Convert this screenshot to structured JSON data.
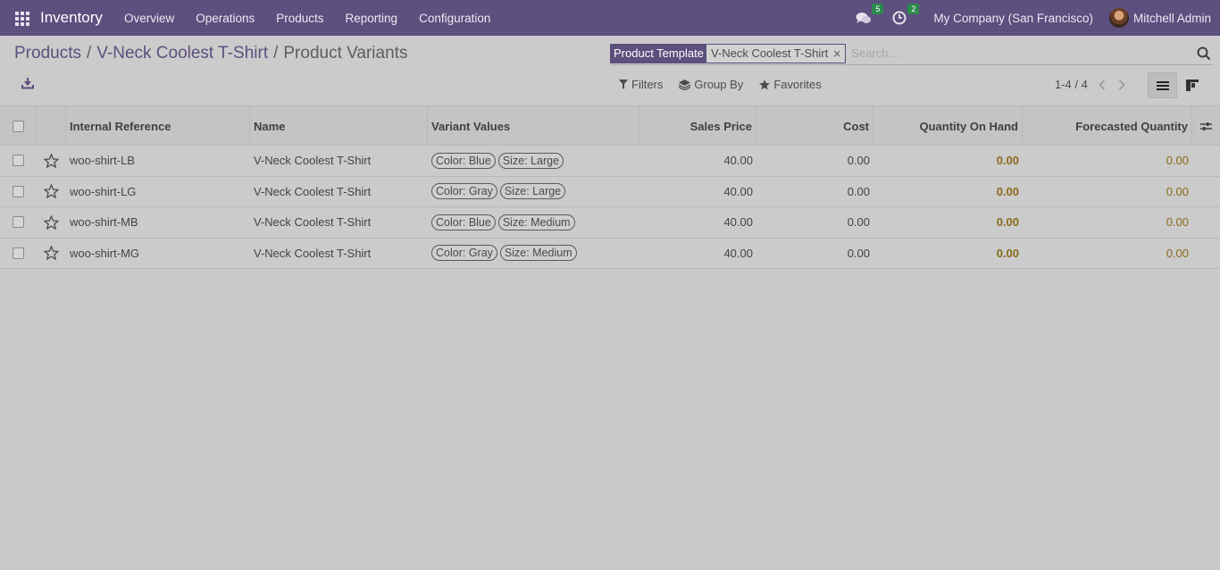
{
  "navbar": {
    "app_name": "Inventory",
    "menu": [
      "Overview",
      "Operations",
      "Products",
      "Reporting",
      "Configuration"
    ],
    "messages_count": "5",
    "activities_count": "2",
    "company": "My Company (San Francisco)",
    "user": "Mitchell Admin",
    "brand_color": "#5d4f7e"
  },
  "breadcrumb": {
    "items": [
      "Products",
      "V-Neck Coolest T-Shirt"
    ],
    "separator": "/",
    "current": "Product Variants"
  },
  "search": {
    "facet_label": "Product Template",
    "facet_value": "V-Neck Coolest T-Shirt",
    "facet_remove": "×",
    "placeholder": "Search..."
  },
  "filters": {
    "filters_label": "Filters",
    "group_by_label": "Group By",
    "favorites_label": "Favorites"
  },
  "pager": {
    "text": "1-4 / 4"
  },
  "table": {
    "headers": {
      "ref": "Internal Reference",
      "name": "Name",
      "variant": "Variant Values",
      "price": "Sales Price",
      "cost": "Cost",
      "qoh": "Quantity On Hand",
      "forecast": "Forecasted Quantity"
    },
    "rows": [
      {
        "ref": "woo-shirt-LB",
        "name": "V-Neck Coolest T-Shirt",
        "color": "Color: Blue",
        "size": "Size: Large",
        "price": "40.00",
        "cost": "0.00",
        "qoh": "0.00",
        "forecast": "0.00"
      },
      {
        "ref": "woo-shirt-LG",
        "name": "V-Neck Coolest T-Shirt",
        "color": "Color: Gray",
        "size": "Size: Large",
        "price": "40.00",
        "cost": "0.00",
        "qoh": "0.00",
        "forecast": "0.00"
      },
      {
        "ref": "woo-shirt-MB",
        "name": "V-Neck Coolest T-Shirt",
        "color": "Color: Blue",
        "size": "Size: Medium",
        "price": "40.00",
        "cost": "0.00",
        "qoh": "0.00",
        "forecast": "0.00"
      },
      {
        "ref": "woo-shirt-MG",
        "name": "V-Neck Coolest T-Shirt",
        "color": "Color: Gray",
        "size": "Size: Medium",
        "price": "40.00",
        "cost": "0.00",
        "qoh": "0.00",
        "forecast": "0.00"
      }
    ]
  }
}
